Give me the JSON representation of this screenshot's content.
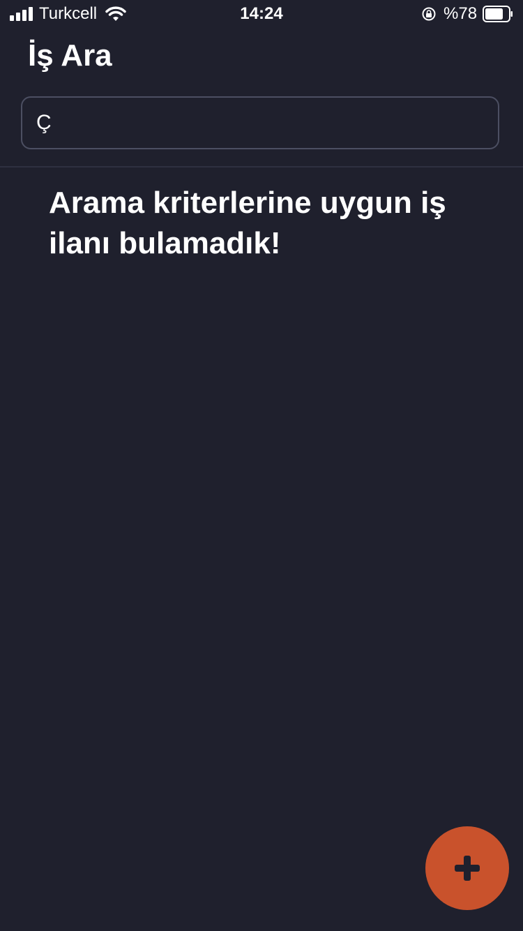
{
  "status_bar": {
    "carrier": "Turkcell",
    "time": "14:24",
    "battery_percent": "%78",
    "battery_level": 0.78,
    "icons": [
      "signal-icon",
      "wifi-icon",
      "rotation-lock-icon",
      "battery-icon"
    ]
  },
  "header": {
    "title": "İş Ara"
  },
  "search": {
    "value": "Ç",
    "icon": "search-icon"
  },
  "results": {
    "empty_message": "Arama kriterlerine uygun iş ilanı bulamadık!"
  },
  "fab": {
    "icon": "plus-icon",
    "color": "#c9522c"
  },
  "colors": {
    "background": "#1f202d",
    "border": "#4c4f62",
    "accent": "#c9522c",
    "text": "#ffffff"
  }
}
